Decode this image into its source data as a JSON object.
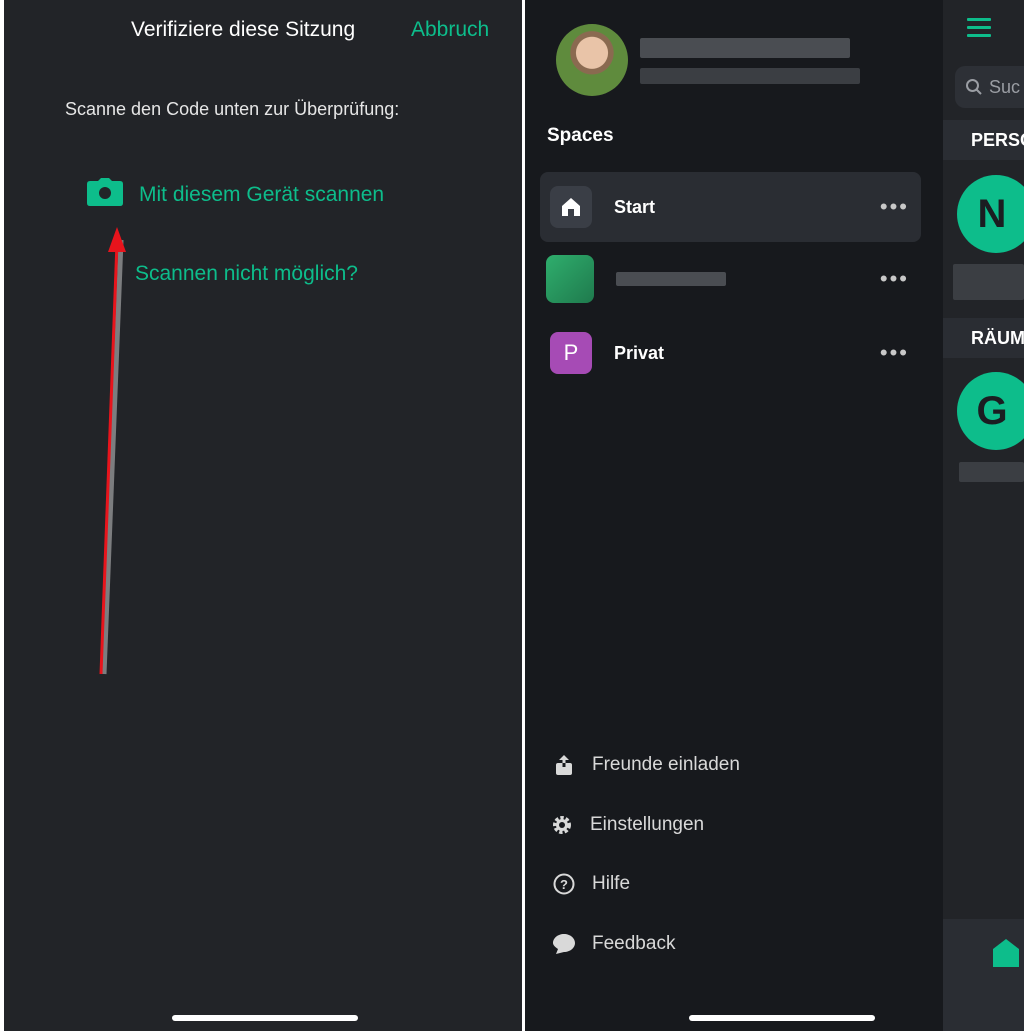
{
  "verify": {
    "title": "Verifiziere diese Sitzung",
    "cancel": "Abbruch",
    "instruction": "Scanne den Code unten zur Überprüfung:",
    "scan_with_device": "Mit diesem Gerät scannen",
    "cannot_scan": "Scannen nicht möglich?"
  },
  "drawer": {
    "spaces_heading": "Spaces",
    "spaces": [
      {
        "label": "Start",
        "icon": "home-icon",
        "active": true
      },
      {
        "label": "",
        "icon": "space-avatar-blurred"
      },
      {
        "label": "Privat",
        "icon_letter": "P",
        "color": "#a64bb5"
      }
    ],
    "menu": [
      {
        "label": "Freunde einladen",
        "icon": "invite-icon"
      },
      {
        "label": "Einstellungen",
        "icon": "gear-icon"
      },
      {
        "label": "Hilfe",
        "icon": "help-icon"
      },
      {
        "label": "Feedback",
        "icon": "chat-bubble-icon"
      }
    ]
  },
  "room_list": {
    "search_placeholder": "Suc",
    "people_heading": "PERSO",
    "rooms_heading": "RÄUM",
    "people_avatar_letter": "N",
    "room_avatar_letter": "G"
  },
  "colors": {
    "accent": "#0dbd8b",
    "annotation_arrow": "#e8141c",
    "background": "#222428"
  }
}
